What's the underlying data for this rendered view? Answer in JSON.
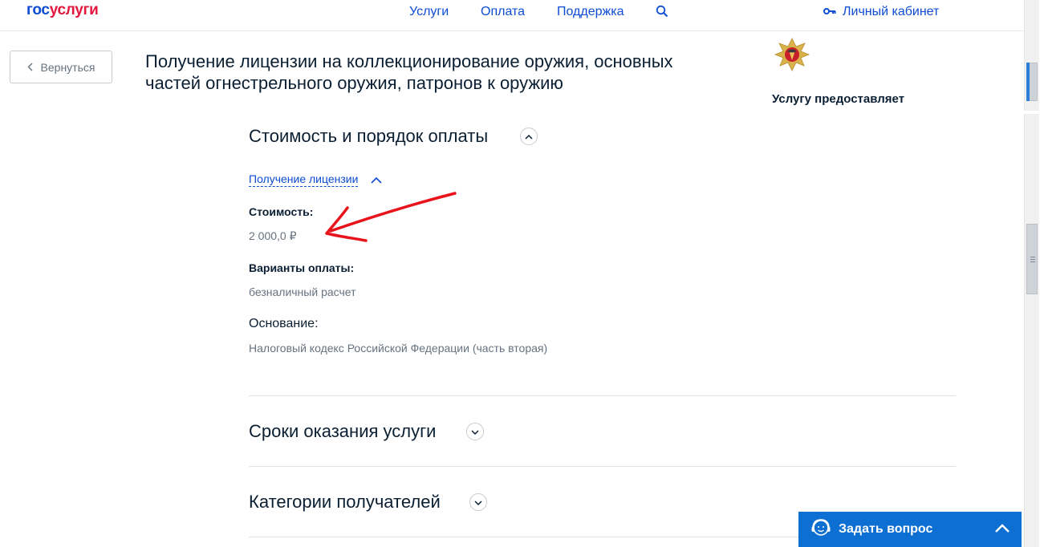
{
  "header": {
    "logo_part1": "гос",
    "logo_part2": "услуги",
    "nav": [
      "Услуги",
      "Оплата",
      "Поддержка"
    ],
    "cabinet_label": "Личный кабинет"
  },
  "back_button": {
    "label": "Вернуться"
  },
  "page_title": "Получение лицензии на коллекционирование оружия, основных частей огнестрельного оружия, патронов к оружию",
  "provider": {
    "label": "Услугу предоставляет"
  },
  "payment_section": {
    "title": "Стоимость и порядок оплаты",
    "subsection_label": "Получение лицензии",
    "cost_label": "Стоимость:",
    "cost_value": "2 000,0 ₽",
    "payment_options_label": "Варианты оплаты:",
    "payment_options_value": "безналичный расчет",
    "basis_label": "Основание:",
    "basis_value": "Налоговый кодекс Российской Федерации (часть вторая)"
  },
  "terms_section": {
    "title": "Сроки оказания услуги"
  },
  "recipients_section": {
    "title": "Категории получателей"
  },
  "ask_widget": {
    "label": "Задать вопрос"
  },
  "colors": {
    "link": "#0d4cd3",
    "brand_red": "#e3173e",
    "widget_blue": "#0d6fd1",
    "annotation_arrow": "#e8141c"
  }
}
